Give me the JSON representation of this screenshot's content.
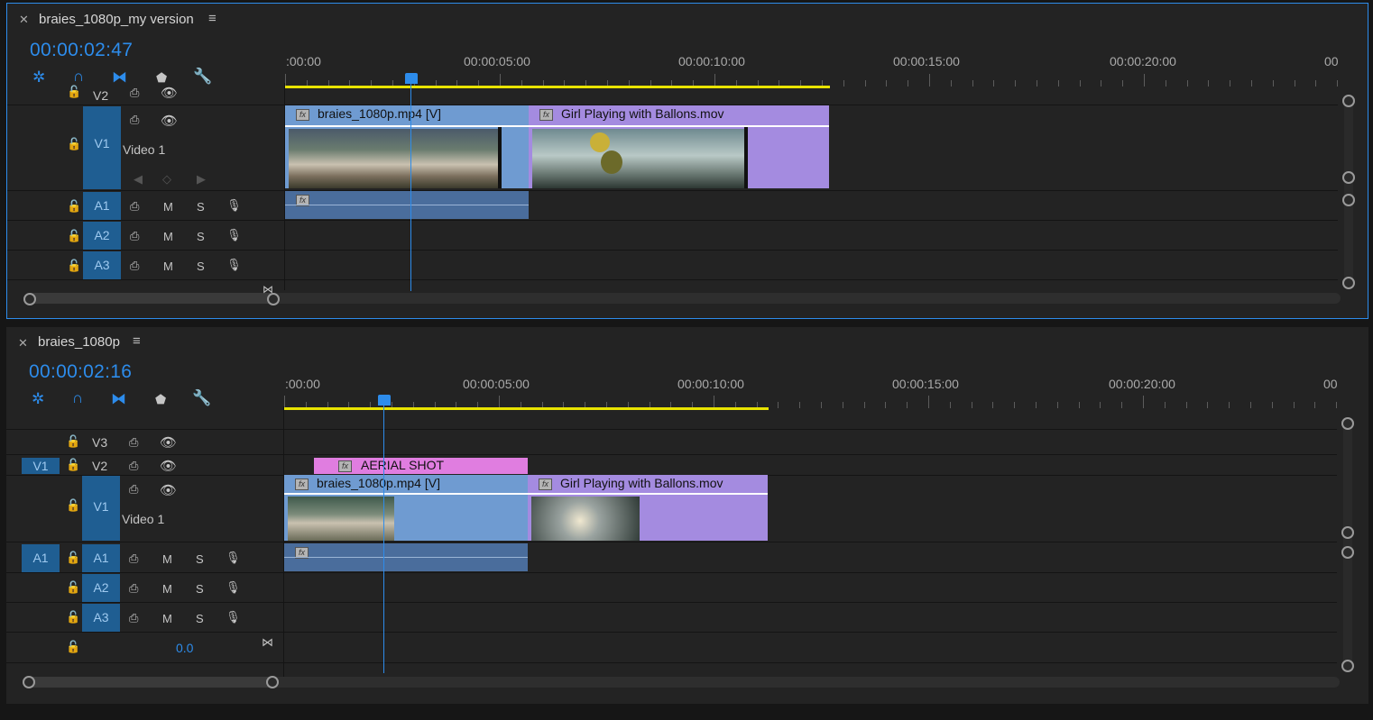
{
  "colors": {
    "accent": "#2d8ceb",
    "video_clip": "#6f9bd1",
    "cyan_clip": "#7aa3d4",
    "purple_clip": "#a48be0",
    "pink_clip": "#e07de0",
    "audio_clip": "#4a6d9c",
    "yellow_bar": "#e8e300"
  },
  "panel1": {
    "title": "braies_1080p_my version",
    "timecode": "00:00:02:47",
    "ruler": [
      ":00:00",
      "00:00:05:00",
      "00:00:10:00",
      "00:00:15:00",
      "00:00:20:00",
      "00"
    ],
    "tracks": {
      "v2": "V2",
      "v1": "V1",
      "v1_name": "Video 1",
      "a1": "A1",
      "a2": "A2",
      "a3": "A3"
    },
    "mute": "M",
    "solo": "S",
    "clips": {
      "video1": "braies_1080p.mp4 [V]",
      "video2": "Girl Playing with Ballons.mov"
    }
  },
  "panel2": {
    "title": "braies_1080p",
    "timecode": "00:00:02:16",
    "ruler": [
      ":00:00",
      "00:00:05:00",
      "00:00:10:00",
      "00:00:15:00",
      "00:00:20:00",
      "00"
    ],
    "tracks": {
      "v3": "V3",
      "v2": "V2",
      "v1": "V1",
      "v1_name": "Video 1",
      "a1": "A1",
      "a2": "A2",
      "a3": "A3",
      "src_v1": "V1",
      "src_a1": "A1",
      "master_value": "0.0"
    },
    "mute": "M",
    "solo": "S",
    "clips": {
      "title": "AERIAL SHOT",
      "video1": "braies_1080p.mp4 [V]",
      "video2": "Girl Playing with Ballons.mov"
    }
  },
  "icons": [
    "close-icon",
    "menu-icon",
    "snap-icon",
    "linked-selection-icon",
    "insert-overwrite-icon",
    "add-marker-icon",
    "wrench-icon",
    "lock-icon",
    "toggle-sync-icon",
    "eye-icon",
    "microphone-icon",
    "fx-icon"
  ]
}
